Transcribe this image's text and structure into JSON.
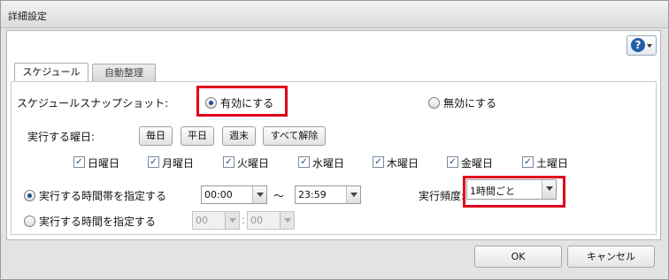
{
  "dialog": {
    "title": "詳細設定"
  },
  "tabs": [
    {
      "label": "スケジュール"
    },
    {
      "label": "自動整理"
    }
  ],
  "snapshot": {
    "label": "スケジュールスナップショット:",
    "enable_label": "有効にする",
    "disable_label": "無効にする",
    "selected": "enable"
  },
  "weekdays": {
    "label": "実行する曜日:",
    "quick_buttons": [
      "毎日",
      "平日",
      "週末",
      "すべて解除"
    ],
    "days": [
      {
        "label": "日曜日",
        "checked": true
      },
      {
        "label": "月曜日",
        "checked": true
      },
      {
        "label": "火曜日",
        "checked": true
      },
      {
        "label": "水曜日",
        "checked": true
      },
      {
        "label": "木曜日",
        "checked": true
      },
      {
        "label": "金曜日",
        "checked": true
      },
      {
        "label": "土曜日",
        "checked": true
      }
    ]
  },
  "time_range": {
    "label": "実行する時間帯を指定する",
    "start": "00:00",
    "separator": "～",
    "end": "23:59",
    "frequency_label": "実行頻度:",
    "frequency_value": "1時間ごと"
  },
  "time_fixed": {
    "label": "実行する時間を指定する",
    "hour": "00",
    "colon": ":",
    "minute": "00"
  },
  "footer": {
    "ok_label": "OK",
    "cancel_label": "キャンセル"
  },
  "colors": {
    "highlight": "#e0001b",
    "radio_dot": "#1d4f91"
  },
  "icons": {
    "help": "question-circle-icon"
  }
}
